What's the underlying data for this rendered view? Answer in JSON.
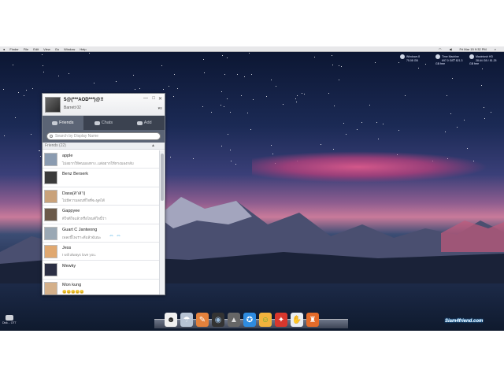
{
  "menubar": {
    "apple": "",
    "items": [
      "Finder",
      "File",
      "Edit",
      "View",
      "Go",
      "Window",
      "Help"
    ],
    "clock": "Fri Mar 15 9:32 PM"
  },
  "widgets": [
    {
      "title": "Windows 8",
      "sub": "75.08 GB"
    },
    {
      "title": "Time Machine",
      "sub": "697.0 GB / 821.3 GB free"
    },
    {
      "title": "Macintosh HD",
      "sub": "28.64 GB / 81.25 GB free"
    }
  ],
  "chat": {
    "my_name": "5@(***AOD***)@!!",
    "my_status": "Barrett 02",
    "win_min": "—",
    "win_max": "□",
    "win_close": "✕",
    "status_menu": "▾≡",
    "tabs": [
      {
        "label": "Friends",
        "active": true
      },
      {
        "label": "Chats",
        "active": false
      },
      {
        "label": "Add",
        "active": false
      }
    ],
    "search_placeholder": "Search by Display Name",
    "group_label": "Friends (22)",
    "group_arrow": "▲",
    "friends": [
      {
        "name": "apple",
        "status": "ไม่อยากให้คนมองทาง..แต่อยากให้ทางมองกลับ",
        "avatar": "#8a9bb0"
      },
      {
        "name": "Benz Berserk",
        "status": "",
        "avatar": "#3a3a3a"
      },
      {
        "name": "Dasa(สาสา)",
        "status": "ไม่มีความสงบที่ใจที่จะพูดได้",
        "avatar": "#c9a27a"
      },
      {
        "name": "Gappyee",
        "status": "ดีใจดีใจแล้วหรือไหมดีใจนี้ว่า",
        "avatar": "#6b5a4a"
      },
      {
        "name": "Guart C Jantwong",
        "status": "เพลงนี้ไพเราะดีแล้วฉันนะ",
        "avatar": "#9aa8b4",
        "emoticon": "⇔ ⇔"
      },
      {
        "name": "Jess",
        "status": "I will always love you.",
        "avatar": "#e0a870"
      },
      {
        "name": "Mewky",
        "status": "",
        "avatar": "#2b2f44"
      },
      {
        "name": "Mon kung",
        "status": "😊😊😊😊😊",
        "avatar": "#d4b08a"
      }
    ]
  },
  "dock": [
    {
      "name": "anonymous-mask",
      "glyph": "☻",
      "bg": "#f0f0f0",
      "fg": "#222"
    },
    {
      "name": "umbrella",
      "glyph": "☂",
      "bg": "#b6c3d4",
      "fg": "#fff"
    },
    {
      "name": "feather",
      "glyph": "✎",
      "bg": "#e3813c",
      "fg": "#fff"
    },
    {
      "name": "camera",
      "glyph": "◉",
      "bg": "#333",
      "fg": "#9bd"
    },
    {
      "name": "stealth",
      "glyph": "▲",
      "bg": "#666",
      "fg": "#ddd"
    },
    {
      "name": "safari",
      "glyph": "✪",
      "bg": "#2e8be0",
      "fg": "#fff"
    },
    {
      "name": "game",
      "glyph": "☺",
      "bg": "#f2b33d",
      "fg": "#5a3"
    },
    {
      "name": "angry-birds",
      "glyph": "✦",
      "bg": "#d8372d",
      "fg": "#fff"
    },
    {
      "name": "finder-glove",
      "glyph": "✋",
      "bg": "#e8edf3",
      "fg": "#667"
    },
    {
      "name": "lighthouse",
      "glyph": "♜",
      "bg": "#e36b2a",
      "fg": "#fff"
    }
  ],
  "disk_label": "Disk... OTT",
  "watermark": "Siam4friend.com"
}
